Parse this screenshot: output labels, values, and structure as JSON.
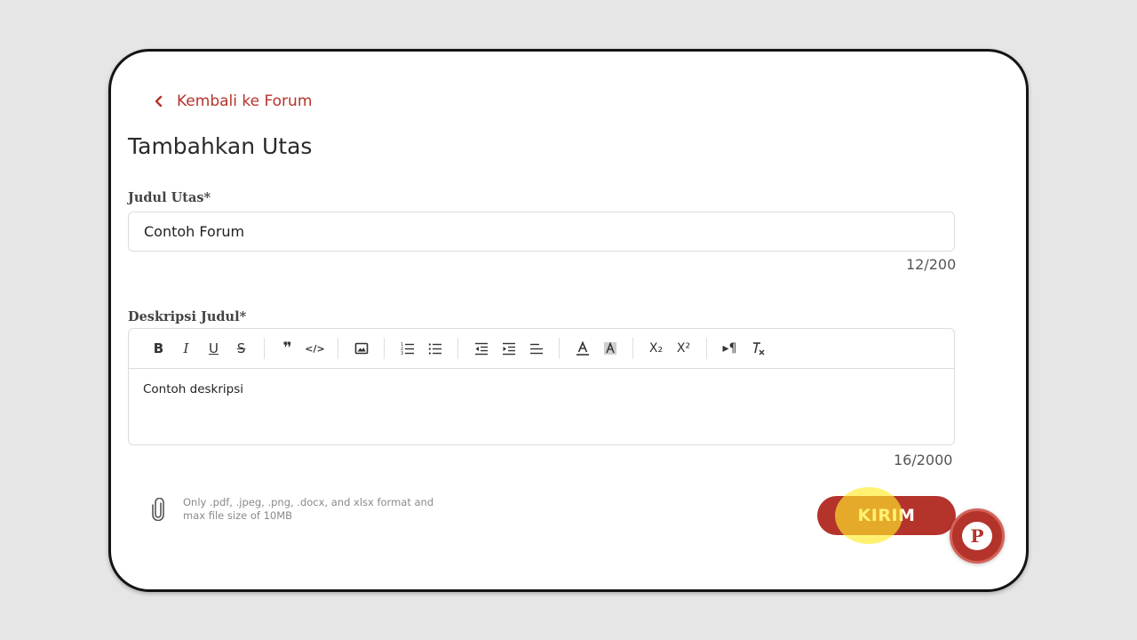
{
  "back_link": {
    "label": "Kembali ke Forum",
    "icon": "chevron-left-icon"
  },
  "page_title": "Tambahkan Utas",
  "title_field": {
    "label": "Judul Utas*",
    "value": "Contoh Forum",
    "counter": "12/200"
  },
  "description_field": {
    "label": "Deskripsi Judul*",
    "content": "Contoh deskripsi",
    "counter": "16/2000",
    "toolbar": {
      "bold": "B",
      "italic": "I",
      "underline": "U",
      "strike": "S",
      "quote": "❞",
      "code": "</>",
      "subscript": "X₂",
      "superscript": "X²",
      "text_direction": "▸¶",
      "color": "A"
    }
  },
  "attachment": {
    "hint": "Only .pdf, .jpeg, .png, .docx, and xlsx format and max file size of 10MB",
    "icon": "paperclip-icon"
  },
  "submit_button": {
    "label": "KIRIM"
  },
  "chat_fab": {
    "letter": "P",
    "icon": "chat-bubble-icon"
  },
  "colors": {
    "accent": "#b4332b",
    "border": "#dcdcdc",
    "highlight": "#ffeb28"
  }
}
